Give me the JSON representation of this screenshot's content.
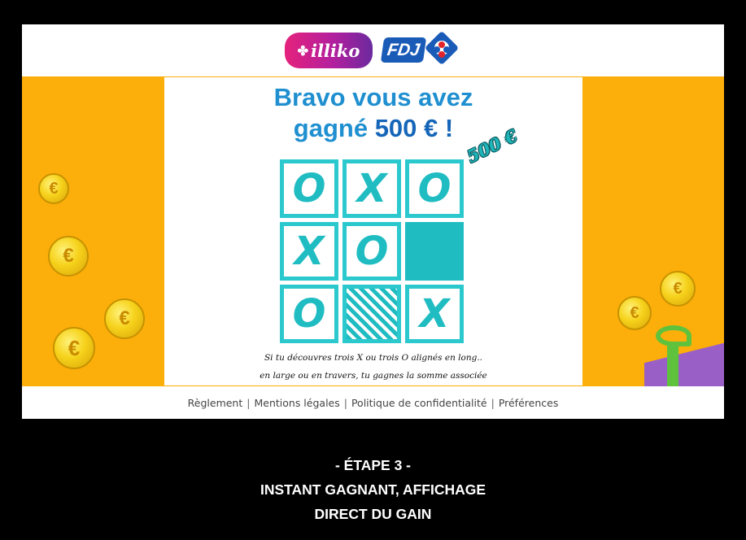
{
  "header": {
    "illiko_logo_text": "illiko",
    "fdj_logo_text": "FDJ"
  },
  "game": {
    "headline_line1": "Bravo vous avez",
    "headline_line2_prefix": "gagné ",
    "headline_amount": "500 € !",
    "prize_tag": "500 €",
    "grid": [
      {
        "symbol": "O",
        "state": "revealed"
      },
      {
        "symbol": "X",
        "state": "revealed"
      },
      {
        "symbol": "O",
        "state": "revealed"
      },
      {
        "symbol": "X",
        "state": "revealed"
      },
      {
        "symbol": "O",
        "state": "revealed"
      },
      {
        "symbol": "",
        "state": "covered"
      },
      {
        "symbol": "O",
        "state": "revealed"
      },
      {
        "symbol": "",
        "state": "scratched"
      },
      {
        "symbol": "X",
        "state": "revealed"
      }
    ],
    "rules_line1": "Si tu découvres trois X ou trois O alignés en long..",
    "rules_line2": "en large ou en travers, tu gagnes la somme associée"
  },
  "footer": {
    "links": [
      "Règlement",
      "Mentions légales",
      "Politique de confidentialité",
      "Préférences"
    ],
    "separator": "|"
  },
  "caption": {
    "line1": "- ÉTAPE 3 -",
    "line2": "INSTANT GAGNANT, AFFICHAGE",
    "line3": "DIRECT DU GAIN"
  },
  "colors": {
    "stage_orange": "#fcae0a",
    "headline_blue": "#1f8fd0",
    "grid_teal": "#2bc8cd",
    "coin_gold": "#f6d21b"
  },
  "icons": [
    "clover-icon",
    "fdj-clover-icon",
    "euro-coin-icon",
    "gift-icon"
  ]
}
